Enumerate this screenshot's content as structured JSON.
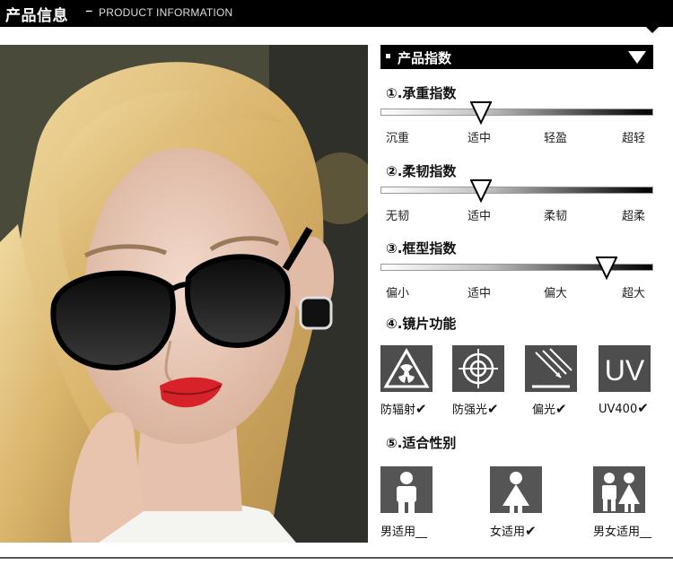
{
  "header": {
    "title": "产品信息",
    "dash": "–",
    "subtitle": "PRODUCT INFORMATION"
  },
  "panel": {
    "heading": "产品指数",
    "indices": [
      {
        "title": "①.承重指数",
        "level": 0.37,
        "labels": [
          "沉重",
          "适中",
          "轻盈",
          "超轻"
        ]
      },
      {
        "title": "②.柔韧指数",
        "level": 0.37,
        "labels": [
          "无韧",
          "适中",
          "柔韧",
          "超柔"
        ]
      },
      {
        "title": "③.框型指数",
        "level": 0.83,
        "labels": [
          "偏小",
          "适中",
          "偏大",
          "超大"
        ]
      }
    ],
    "lens": {
      "title": "④.镜片功能",
      "items": [
        {
          "label": "防辐射",
          "icon": "radiation-icon",
          "checked": "✔"
        },
        {
          "label": "防强光",
          "icon": "crosshair-icon",
          "checked": "✔"
        },
        {
          "label": "偏光",
          "icon": "polarized-light-icon",
          "checked": "✔"
        },
        {
          "label": "UV400",
          "icon": "uv-icon",
          "icon_text": "UV",
          "checked": "✔"
        }
      ]
    },
    "gender": {
      "title": "⑤.适合性别",
      "items": [
        {
          "label": "男适用",
          "icon": "male-icon",
          "mark": "__"
        },
        {
          "label": "女适用",
          "icon": "female-icon",
          "mark": "✔"
        },
        {
          "label": "男女适用",
          "icon": "unisex-icon",
          "mark": "__"
        }
      ]
    }
  },
  "colors": {
    "header_bg": "#000000",
    "icon_box": "#4d4d4d",
    "track_dark": "#000000"
  }
}
